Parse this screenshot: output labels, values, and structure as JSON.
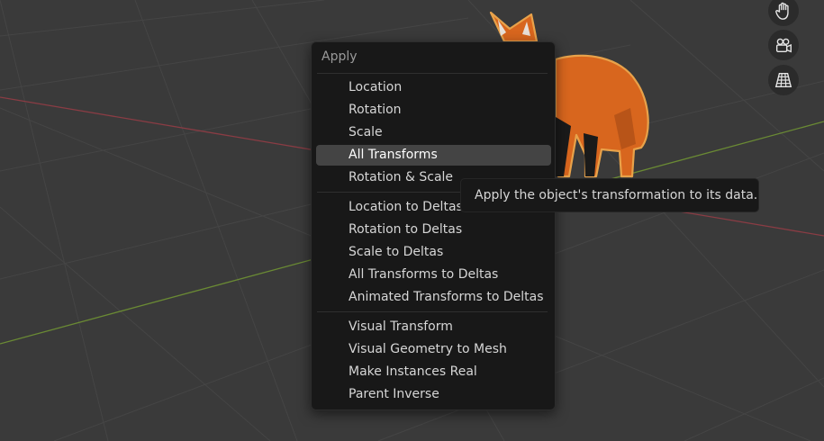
{
  "menu": {
    "title": "Apply",
    "highlighted_index": 3,
    "groups": [
      [
        {
          "label": "Location"
        },
        {
          "label": "Rotation"
        },
        {
          "label": "Scale"
        },
        {
          "label": "All Transforms"
        },
        {
          "label": "Rotation & Scale"
        }
      ],
      [
        {
          "label": "Location to Deltas"
        },
        {
          "label": "Rotation to Deltas"
        },
        {
          "label": "Scale to Deltas"
        },
        {
          "label": "All Transforms to Deltas"
        },
        {
          "label": "Animated Transforms to Deltas"
        }
      ],
      [
        {
          "label": "Visual Transform"
        },
        {
          "label": "Visual Geometry to Mesh"
        },
        {
          "label": "Make Instances Real"
        },
        {
          "label": "Parent Inverse"
        }
      ]
    ]
  },
  "tooltip": {
    "text": "Apply the object's transformation to its data."
  },
  "side_buttons": [
    {
      "icon": "hand-pan-icon"
    },
    {
      "icon": "camera-icon"
    },
    {
      "icon": "perspective-grid-icon"
    }
  ],
  "colors": {
    "viewport_bg": "#3a3a3a",
    "grid_line": "#454545",
    "x_axis": "#8a3c44",
    "y_axis": "#6a8a34",
    "fox_orange": "#d8661e",
    "selection_outline": "#e8a24a",
    "menu_bg": "#181818",
    "highlight": "#444444"
  }
}
